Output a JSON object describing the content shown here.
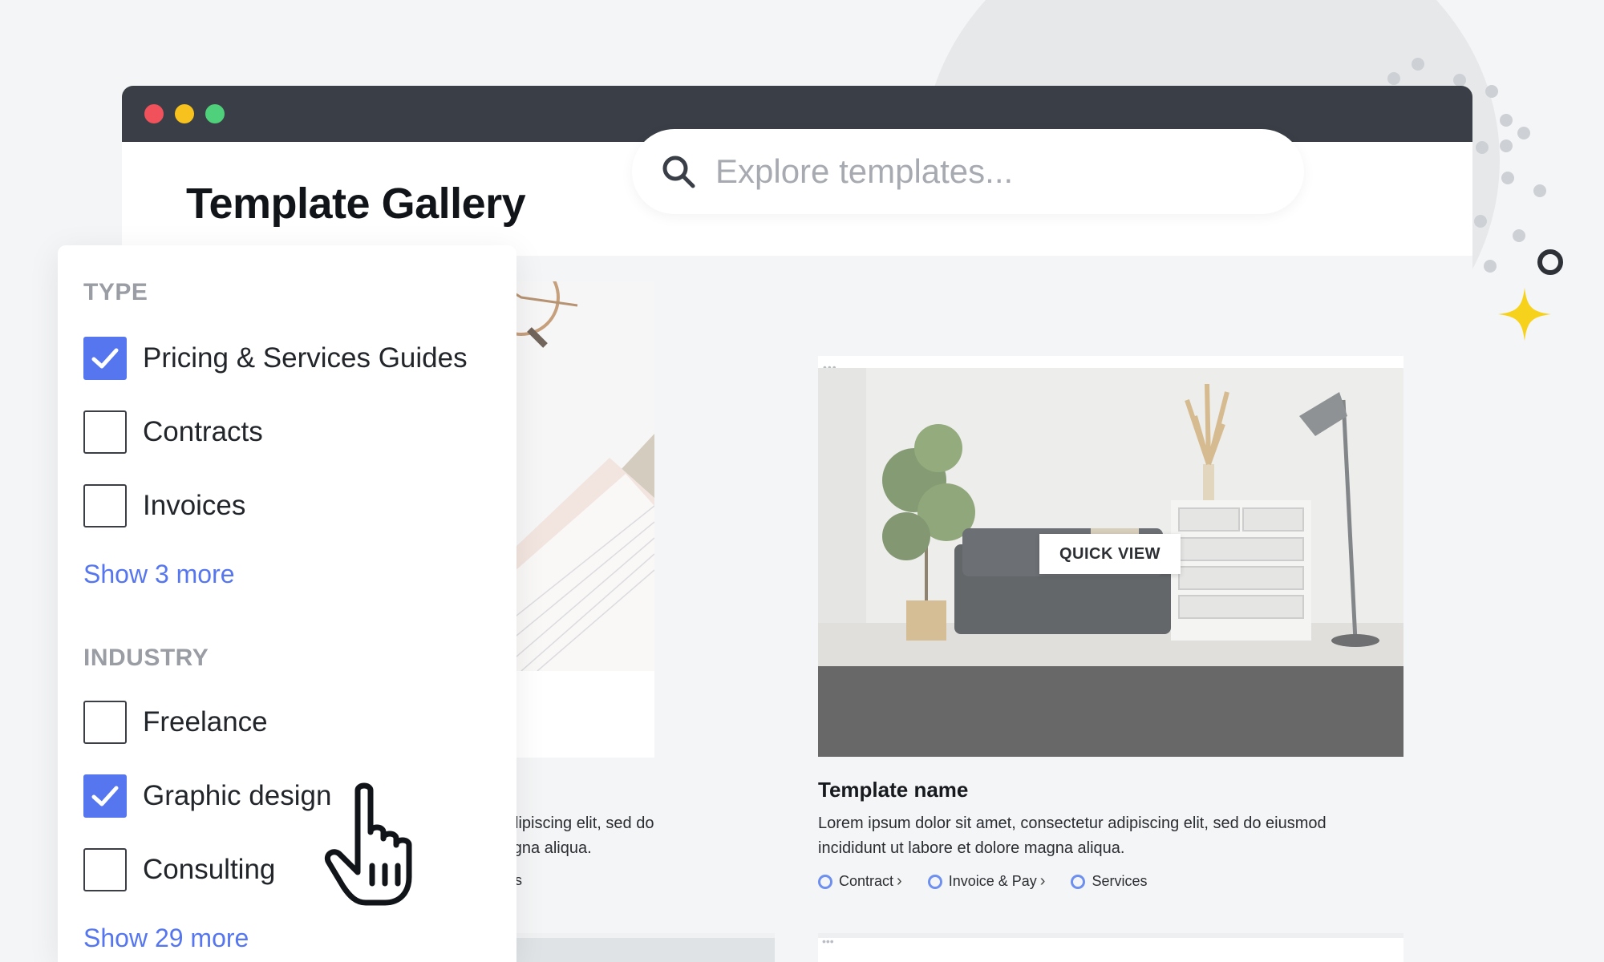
{
  "window": {
    "controls": [
      "close",
      "minimize",
      "maximize"
    ]
  },
  "page": {
    "title": "Template Gallery"
  },
  "search": {
    "placeholder": "Explore templates...",
    "value": ""
  },
  "filters": {
    "type": {
      "heading": "TYPE",
      "options": [
        {
          "label": "Pricing & Services Guides",
          "checked": true
        },
        {
          "label": "Contracts",
          "checked": false
        },
        {
          "label": "Invoices",
          "checked": false
        }
      ],
      "show_more": "Show 3 more"
    },
    "industry": {
      "heading": "INDUSTRY",
      "options": [
        {
          "label": "Freelance",
          "checked": false
        },
        {
          "label": "Graphic design",
          "checked": true
        },
        {
          "label": "Consulting",
          "checked": false
        }
      ],
      "show_more": "Show 29 more"
    }
  },
  "cards": {
    "left": {
      "desc_line1": "r adipiscing elit, sed do",
      "desc_line2": "magna aliqua.",
      "tag_tail": "s"
    },
    "right": {
      "quick_view": "QUICK VIEW",
      "title": "Template name",
      "description": "Lorem ipsum dolor sit amet, consectetur adipiscing elit, sed do eiusmod incididunt ut labore et dolore magna aliqua.",
      "tags": [
        "Contract",
        "Invoice & Pay",
        "Services"
      ]
    }
  },
  "colors": {
    "accent": "#5676ef",
    "titlebar": "#3a3f47",
    "close": "#f0515a",
    "minimize": "#f7c21d",
    "maximize": "#4fd07a",
    "sparkle": "#f7d21d"
  },
  "icons": [
    "search-icon",
    "checkmark-icon",
    "chevron-right-icon",
    "hand-pointer-icon",
    "sparkle-icon",
    "ring-icon"
  ]
}
